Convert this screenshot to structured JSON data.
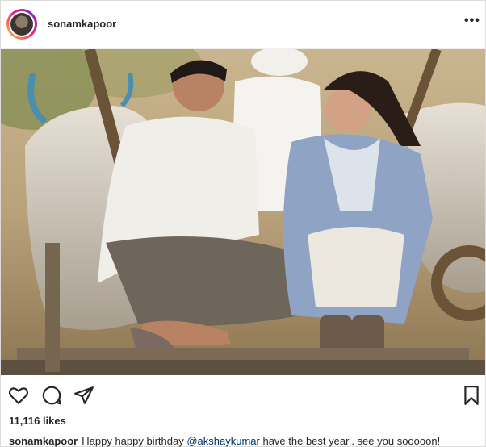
{
  "post": {
    "username": "sonamkapoor",
    "more_glyph": "•••",
    "photo_description_icon": "photo",
    "likes": "11,116 likes",
    "caption": {
      "username": "sonamkapoor",
      "text_before": "Happy happy birthday ",
      "mention": "@akshaykumar",
      "text_after": " have the best year.. see you sooooon!"
    },
    "icons": {
      "like": "heart-icon",
      "comment": "comment-icon",
      "share": "share-icon",
      "save": "bookmark-icon"
    }
  }
}
